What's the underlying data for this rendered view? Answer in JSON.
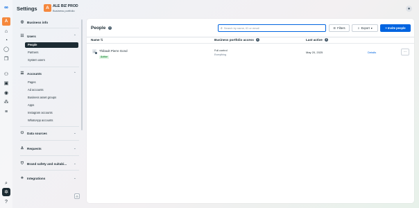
{
  "app": {
    "title": "Settings"
  },
  "business": {
    "initial": "A",
    "name": "ALE BIZ PROD",
    "type": "Business portfolio"
  },
  "rail": {
    "logo_icon": "meta-logo-icon",
    "avatar_initial": "A",
    "icons": [
      "home-icon",
      "notifications-icon",
      "messages-icon",
      "pages-icon",
      "audience-icon",
      "ads-icon",
      "billing-icon",
      "insights-icon",
      "menu-icon",
      "search-icon",
      "settings-icon",
      "help-icon"
    ]
  },
  "sidebar": {
    "business_info": "Business info",
    "users": {
      "label": "Users",
      "items": [
        "People",
        "Partners",
        "System users"
      ]
    },
    "accounts": {
      "label": "Accounts",
      "items": [
        "Pages",
        "Ad accounts",
        "Business asset groups",
        "Apps",
        "Instagram accounts",
        "WhatsApp accounts"
      ]
    },
    "data_sources": "Data sources",
    "requests": "Requests",
    "brand_safety": "Brand safety and suitabi...",
    "integrations": "Integrations"
  },
  "main": {
    "title": "People",
    "search_placeholder": "Search by name, ID or email",
    "filters_label": "Filters",
    "export_label": "Export",
    "invite_label": "+ Invite people",
    "columns": {
      "name": "Name",
      "access": "Business portfolio access",
      "last_active": "Last active"
    },
    "rows": [
      {
        "name": "Thibault Pierre Gond",
        "status": "Active",
        "access": "Full control",
        "access_detail": "Everything",
        "last_active": "May 20, 2025",
        "action": "Details"
      }
    ]
  },
  "colors": {
    "accent": "#0064e0",
    "brand_orange": "#f5883d",
    "active_green": "#1f8a3b",
    "dark": "#1c2b33"
  }
}
